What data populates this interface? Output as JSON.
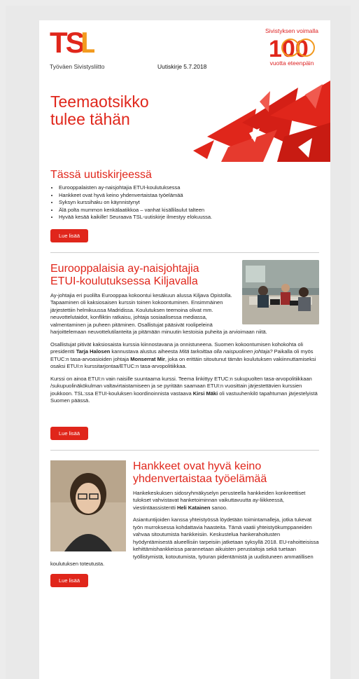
{
  "header": {
    "logo_text": "TSL",
    "org_name": "Työväen Sivistysliitto",
    "issue": "Uutiskirje 5.7.2018",
    "anniversary_top": "Sivistyksen voimalla",
    "anniversary_number": "100",
    "anniversary_bottom": "vuotta eteenpäin"
  },
  "hero": {
    "title": "Teemaotsikko tulee tähän"
  },
  "toc": {
    "heading": "Tässä uutiskirjeessä",
    "items": [
      "Eurooppalaisten ay-naisjohtajia ETUI-koulutuksessa",
      "Hankkeet ovat hyvä keino yhdenvertaistaa työelämää",
      "Syksyn kurssihaku on käynnistynyt",
      "Älä polta mummon kenkälaatikkoa – vanhat kisällilaulut talteen",
      "Hyvää kesää kaikille! Seuraava TSL-uutiskirje ilmestyy elokuussa."
    ],
    "button": "Lue lisää"
  },
  "article1": {
    "title": "Eurooppalaisia ay-naisjohtajia ETUI-koulutuksessa Kiljavalla",
    "p1": "Ay-johtajia eri puolilta Eurooppaa kokoontui kesäkuun alussa Kiljava Opistolla. Tapaaminen oli kaksiosaisen kurssin toinen kokoontuminen. Ensimmäinen järjestettiin helmikuussa Madridissa. Koulutuksen teemoina olivat mm. neuvottelutaidot, konfliktin ratkaisu, johtaja sosiaalisessa mediassa, valmentaminen ja puheen pitäminen. Osallistujat pääsivät roolipeleinä harjoittelemaan neuvottelutilanteita ja pitämään minuutin kestoisia puheita ja arvioimaan niitä.",
    "p2_a": "Osallistujat pitivät kaksiosaista kurssia kiinnostavana ja onnistuneena. Suomen kokoontumisen kohokohta oli presidentti ",
    "p2_b": "Tarja Halosen",
    "p2_c": " kannustava alustus aiheesta ",
    "p2_d": "Mitä tarkoittaa olla naispuolinen johtaja?",
    "p2_e": " Paikalla oli myös ETUC:n tasa-arvoasioiden johtaja ",
    "p2_f": "Monserrat Mir",
    "p2_g": ", joka on erittäin sitoutunut tämän koulutuksen vakiinnuttamiseksi osaksi ETUI:n kurssitarjontaa/ETUC:n tasa-arvopolitiikkaa.",
    "p3_a": "Kurssi on ainoa ETUI:n vain naisille suuntaama kurssi. Teema linkittyy ETUC:n sukupuolten tasa-arvopolitiikkaan /sukupuolinäkökulman valtavirtaistamiseen ja se pyritään saamaan ETUI:n vuosittain järjestettävien kurssien joukkoon. TSL:ssa ETUI-kouluksen koordinoinnista vastaava ",
    "p3_b": "Kirsi Mäki",
    "p3_c": " oli vastuuhenkilö tapahtuman järjestelyistä Suomen päässä.",
    "button": "Lue lisää"
  },
  "article2": {
    "title": "Hankkeet ovat hyvä keino yhdenvertaistaa työelämää",
    "p1_a": "Hankekeskuksen sidosryhmäkyselyn perusteella hankkeiden konkreettiset tulokset vahvistavat hanketoiminnan vaikuttavuutta ay-liikkeessä, viestintäassistentti ",
    "p1_b": "Heli Katainen",
    "p1_c": " sanoo.",
    "p2": "Asiantuntijoiden kanssa yhteistyössä löydetään toimintamalleja, jotka tukevat työn murroksessa kohdattavia haasteita. Tämä vaatii yhteistyökumppaneiden vahvaa sitoutumista hankkeisiin. Keskustelua hankerahoitusten hyödyntämisestä alueellisiin tarpeisiin jatketaan syksyllä 2018. EU-rahoitteisissa kehittämishankkeissa parannetaan aikuisten perustaitoja sekä tuetaan työllistymistä, kotoutumista, työuran pidentämistä ja uudistuneen ammatillisen koulutuksen toteutusta.",
    "button": "Lue lisää"
  },
  "colors": {
    "accent": "#e0261b",
    "logo_orange": "#f29a1f",
    "background": "#e9e9e9"
  }
}
